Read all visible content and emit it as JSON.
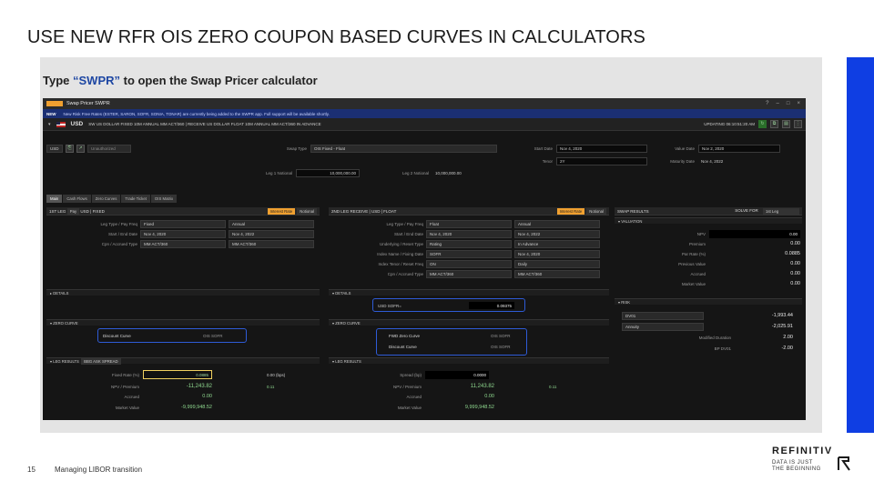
{
  "slide": {
    "title": "USE NEW RFR OIS ZERO COUPON BASED CURVES IN CALCULATORS",
    "subtitle_pre": "Type ",
    "subtitle_code": "“SWPR”",
    "subtitle_post": " to open the Swap Pricer calculator",
    "page_number": "15",
    "footer": "Managing LIBOR transition",
    "logo_word": "REFINITIV",
    "logo_tag_1": "DATA IS JUST",
    "logo_tag_2": "THE BEGINNING",
    "accent_color": "#0f3ee3"
  },
  "app": {
    "title": "Swap Pricer SWPR",
    "notice_new": "NEW",
    "notice_text": "New Risk Free Rates (ESTER, SARON, SOFR, SONIA, TONAR) are currently being added to the SWPR app. Full support will be available shortly.",
    "ccy": "USD",
    "ccy_desc": "SW US DOLLAR FIXED 10M ANNUAL MM ACT/360 | RECEIVE US DOLLAR FLOAT 10M ANNUAL MM ACT/360 IN ADVANCE",
    "update_text": "UPDATING 06:10:51:20 AM",
    "toolbar": {
      "ccy_select": "USD",
      "unauth": "Unauthorized",
      "swap_type_label": "Swap Type",
      "swap_type": "OIS Fixed - Float",
      "start_date_label": "Start Date",
      "start_date": "Nov 4, 2020",
      "tenor_label": "Tenor",
      "tenor": "2Y",
      "value_date_label": "Value Date",
      "value_date": "Nov 2, 2020",
      "maturity_date_label": "Maturity Date",
      "maturity_date": "Nov 4, 2022",
      "leg1_notional_label": "Leg 1 Notional",
      "leg1_notional": "10,000,000.00",
      "leg2_notional_label": "Leg 2 Notional",
      "leg2_notional": "10,000,000.00"
    },
    "tabs": [
      "Main",
      "Cash Flows",
      "Zero Curves",
      "Trade Ticket",
      "OIS Matrix"
    ],
    "leg1": {
      "header": "1ST LEG",
      "pay": "Pay",
      "ccy": "USD",
      "type": "FIXED",
      "mode_a": "Interest Rate",
      "mode_b": "Notional",
      "fields": [
        {
          "label": "Leg Type / Pay Freq",
          "a": "Fixed",
          "b": "Annual"
        },
        {
          "label": "Start / End Date",
          "a": "Nov 4, 2020",
          "b": "Nov 4, 2022"
        },
        {
          "label": "Cpn / Accrued Type",
          "a": "MM ACT/360",
          "b": "MM ACT/360"
        }
      ],
      "details": "DETAILS",
      "zero_curve": "ZERO CURVE",
      "discount_label": "Discount Curve",
      "discount_value": "OIS SOFR",
      "leg_results": "LEG RESULTS",
      "result_opt": "BBG ASK SPREAD",
      "fixed_rate_label": "Fixed Rate (%)",
      "fixed_rate": "0.0885",
      "bps": "0.00 (bps)",
      "npv_label": "NPV / Premium",
      "npv": "-11,243.82",
      "npv_side": "0.11",
      "accrued_label": "Accrued",
      "accrued": "0.00",
      "mv_label": "Market Value",
      "mv": "-9,999,948.52"
    },
    "leg2": {
      "header": "2ND LEG",
      "receive": "RECEIVE",
      "ccy": "USD",
      "type": "FLOAT",
      "mode_a": "Interest Rate",
      "mode_b": "Notional",
      "fields": [
        {
          "label": "Leg Type / Pay Freq",
          "a": "Float",
          "b": "Annual"
        },
        {
          "label": "Start / End Date",
          "a": "Nov 4, 2020",
          "b": "Nov 4, 2022"
        },
        {
          "label": "Underlying / Reset Type",
          "a": "Rating",
          "b": "In Advance"
        },
        {
          "label": "Index Name / Fixing Date",
          "a": "SOFR",
          "b": "Nov 4, 2020"
        },
        {
          "label": "Index Tenor / Reset Freq",
          "a": "ON",
          "b": "Daily"
        },
        {
          "label": "Cpn / Accrued Type",
          "a": "MM ACT/360",
          "b": "MM ACT/360"
        }
      ],
      "details": "DETAILS",
      "index_label": "USD SOFR=",
      "index_value": "0.09375",
      "zero_curve": "ZERO CURVE",
      "fwd_label": "FWD Zero Curve",
      "fwd_value": "OIS SOFR",
      "discount_label": "Discount Curve",
      "discount_value": "OIS SOFR",
      "leg_results": "LEG RESULTS",
      "spread_label": "Spread (bp)",
      "spread": "0.0000",
      "npv_label": "NPV / Premium",
      "npv": "11,243.82",
      "npv_side": "0.11",
      "accrued_label": "Accrued",
      "accrued": "0.00",
      "mv_label": "Market Value",
      "mv": "9,999,948.52"
    },
    "results": {
      "header": "SWAP RESULTS",
      "solve_for_label": "SOLVE FOR",
      "solve_for": "1st Leg",
      "valuation": "VALUATION",
      "rows": [
        {
          "label": "NPV",
          "value": "0.00"
        },
        {
          "label": "Premium",
          "value": "0.00"
        },
        {
          "label": "Par Rate (%)",
          "value": "0.0885"
        },
        {
          "label": "Previous Value",
          "value": "0.00"
        },
        {
          "label": "Accrued",
          "value": "0.00"
        },
        {
          "label": "Market Value",
          "value": "0.00"
        }
      ],
      "risk": "RISK",
      "dv01_label": "DV01",
      "dv01": "-1,993.44",
      "annuity_label": "Annuity",
      "annuity": "-2,025.91",
      "mod_dur_label": "Modified Duration",
      "mod_dur": "2.00",
      "bp_dv01_label": "BP DV01",
      "bp_dv01": "-2.00"
    }
  }
}
